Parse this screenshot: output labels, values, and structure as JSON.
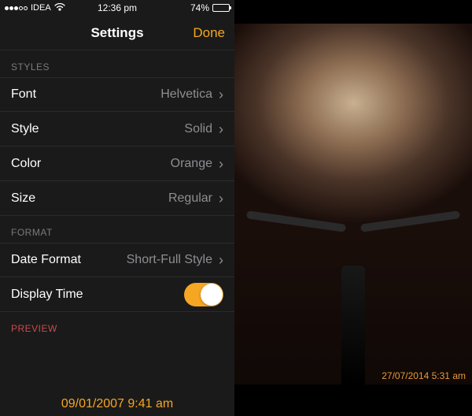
{
  "status": {
    "carrier": "IDEA",
    "time": "12:36 pm",
    "battery_pct": "74%"
  },
  "nav": {
    "title": "Settings",
    "done": "Done"
  },
  "sections": {
    "styles_header": "STYLES",
    "format_header": "FORMAT",
    "preview_header": "PREVIEW"
  },
  "rows": {
    "font": {
      "label": "Font",
      "value": "Helvetica"
    },
    "style": {
      "label": "Style",
      "value": "Solid"
    },
    "color": {
      "label": "Color",
      "value": "Orange"
    },
    "size": {
      "label": "Size",
      "value": "Regular"
    },
    "date_format": {
      "label": "Date Format",
      "value": "Short-Full Style"
    },
    "display_time": {
      "label": "Display Time",
      "on": true
    }
  },
  "preview_text": "09/01/2007  9:41 am",
  "photo_timestamp": "27/07/2014  5:31 am"
}
